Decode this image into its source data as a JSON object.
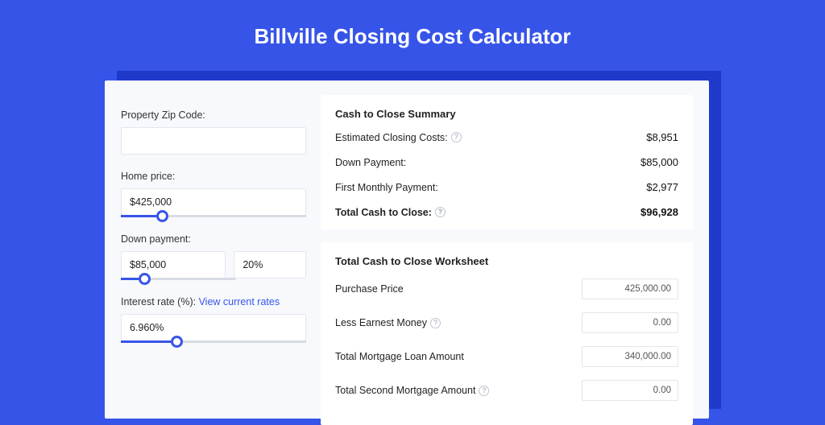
{
  "title": "Billville Closing Cost Calculator",
  "inputs": {
    "zip_label": "Property Zip Code:",
    "zip_value": "",
    "home_price_label": "Home price:",
    "home_price_value": "$425,000",
    "home_price_slider_pct": 22,
    "down_payment_label": "Down payment:",
    "down_payment_value": "$85,000",
    "down_payment_pct_value": "20%",
    "down_payment_slider_pct": 20,
    "interest_label": "Interest rate (%): ",
    "interest_link": "View current rates",
    "interest_value": "6.960%",
    "interest_slider_pct": 30
  },
  "summary": {
    "title": "Cash to Close Summary",
    "rows": [
      {
        "label": "Estimated Closing Costs:",
        "help": true,
        "value": "$8,951"
      },
      {
        "label": "Down Payment:",
        "help": false,
        "value": "$85,000"
      },
      {
        "label": "First Monthly Payment:",
        "help": false,
        "value": "$2,977"
      }
    ],
    "total_label": "Total Cash to Close:",
    "total_value": "$96,928"
  },
  "worksheet": {
    "title": "Total Cash to Close Worksheet",
    "rows": [
      {
        "label": "Purchase Price",
        "help": false,
        "value": "425,000.00"
      },
      {
        "label": "Less Earnest Money",
        "help": true,
        "value": "0.00"
      },
      {
        "label": "Total Mortgage Loan Amount",
        "help": false,
        "value": "340,000.00"
      },
      {
        "label": "Total Second Mortgage Amount",
        "help": true,
        "value": "0.00"
      }
    ]
  }
}
